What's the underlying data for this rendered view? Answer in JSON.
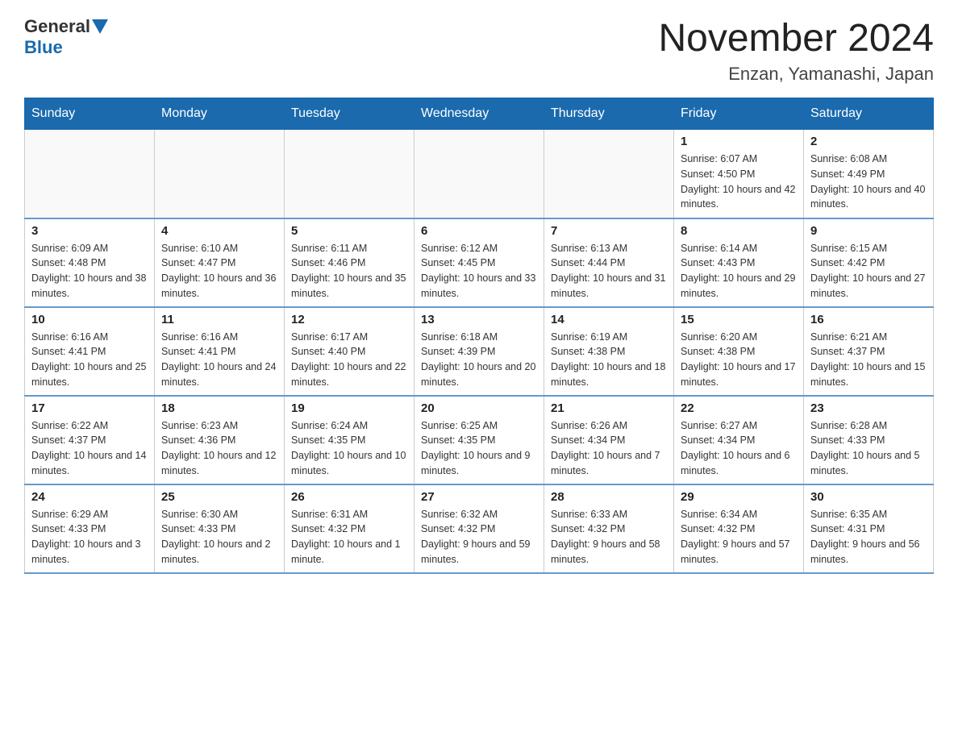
{
  "header": {
    "logo": {
      "general": "General",
      "blue": "Blue"
    },
    "title": "November 2024",
    "location": "Enzan, Yamanashi, Japan"
  },
  "calendar": {
    "days_of_week": [
      "Sunday",
      "Monday",
      "Tuesday",
      "Wednesday",
      "Thursday",
      "Friday",
      "Saturday"
    ],
    "weeks": [
      [
        {
          "day": "",
          "info": ""
        },
        {
          "day": "",
          "info": ""
        },
        {
          "day": "",
          "info": ""
        },
        {
          "day": "",
          "info": ""
        },
        {
          "day": "",
          "info": ""
        },
        {
          "day": "1",
          "info": "Sunrise: 6:07 AM\nSunset: 4:50 PM\nDaylight: 10 hours and 42 minutes."
        },
        {
          "day": "2",
          "info": "Sunrise: 6:08 AM\nSunset: 4:49 PM\nDaylight: 10 hours and 40 minutes."
        }
      ],
      [
        {
          "day": "3",
          "info": "Sunrise: 6:09 AM\nSunset: 4:48 PM\nDaylight: 10 hours and 38 minutes."
        },
        {
          "day": "4",
          "info": "Sunrise: 6:10 AM\nSunset: 4:47 PM\nDaylight: 10 hours and 36 minutes."
        },
        {
          "day": "5",
          "info": "Sunrise: 6:11 AM\nSunset: 4:46 PM\nDaylight: 10 hours and 35 minutes."
        },
        {
          "day": "6",
          "info": "Sunrise: 6:12 AM\nSunset: 4:45 PM\nDaylight: 10 hours and 33 minutes."
        },
        {
          "day": "7",
          "info": "Sunrise: 6:13 AM\nSunset: 4:44 PM\nDaylight: 10 hours and 31 minutes."
        },
        {
          "day": "8",
          "info": "Sunrise: 6:14 AM\nSunset: 4:43 PM\nDaylight: 10 hours and 29 minutes."
        },
        {
          "day": "9",
          "info": "Sunrise: 6:15 AM\nSunset: 4:42 PM\nDaylight: 10 hours and 27 minutes."
        }
      ],
      [
        {
          "day": "10",
          "info": "Sunrise: 6:16 AM\nSunset: 4:41 PM\nDaylight: 10 hours and 25 minutes."
        },
        {
          "day": "11",
          "info": "Sunrise: 6:16 AM\nSunset: 4:41 PM\nDaylight: 10 hours and 24 minutes."
        },
        {
          "day": "12",
          "info": "Sunrise: 6:17 AM\nSunset: 4:40 PM\nDaylight: 10 hours and 22 minutes."
        },
        {
          "day": "13",
          "info": "Sunrise: 6:18 AM\nSunset: 4:39 PM\nDaylight: 10 hours and 20 minutes."
        },
        {
          "day": "14",
          "info": "Sunrise: 6:19 AM\nSunset: 4:38 PM\nDaylight: 10 hours and 18 minutes."
        },
        {
          "day": "15",
          "info": "Sunrise: 6:20 AM\nSunset: 4:38 PM\nDaylight: 10 hours and 17 minutes."
        },
        {
          "day": "16",
          "info": "Sunrise: 6:21 AM\nSunset: 4:37 PM\nDaylight: 10 hours and 15 minutes."
        }
      ],
      [
        {
          "day": "17",
          "info": "Sunrise: 6:22 AM\nSunset: 4:37 PM\nDaylight: 10 hours and 14 minutes."
        },
        {
          "day": "18",
          "info": "Sunrise: 6:23 AM\nSunset: 4:36 PM\nDaylight: 10 hours and 12 minutes."
        },
        {
          "day": "19",
          "info": "Sunrise: 6:24 AM\nSunset: 4:35 PM\nDaylight: 10 hours and 10 minutes."
        },
        {
          "day": "20",
          "info": "Sunrise: 6:25 AM\nSunset: 4:35 PM\nDaylight: 10 hours and 9 minutes."
        },
        {
          "day": "21",
          "info": "Sunrise: 6:26 AM\nSunset: 4:34 PM\nDaylight: 10 hours and 7 minutes."
        },
        {
          "day": "22",
          "info": "Sunrise: 6:27 AM\nSunset: 4:34 PM\nDaylight: 10 hours and 6 minutes."
        },
        {
          "day": "23",
          "info": "Sunrise: 6:28 AM\nSunset: 4:33 PM\nDaylight: 10 hours and 5 minutes."
        }
      ],
      [
        {
          "day": "24",
          "info": "Sunrise: 6:29 AM\nSunset: 4:33 PM\nDaylight: 10 hours and 3 minutes."
        },
        {
          "day": "25",
          "info": "Sunrise: 6:30 AM\nSunset: 4:33 PM\nDaylight: 10 hours and 2 minutes."
        },
        {
          "day": "26",
          "info": "Sunrise: 6:31 AM\nSunset: 4:32 PM\nDaylight: 10 hours and 1 minute."
        },
        {
          "day": "27",
          "info": "Sunrise: 6:32 AM\nSunset: 4:32 PM\nDaylight: 9 hours and 59 minutes."
        },
        {
          "day": "28",
          "info": "Sunrise: 6:33 AM\nSunset: 4:32 PM\nDaylight: 9 hours and 58 minutes."
        },
        {
          "day": "29",
          "info": "Sunrise: 6:34 AM\nSunset: 4:32 PM\nDaylight: 9 hours and 57 minutes."
        },
        {
          "day": "30",
          "info": "Sunrise: 6:35 AM\nSunset: 4:31 PM\nDaylight: 9 hours and 56 minutes."
        }
      ]
    ]
  }
}
